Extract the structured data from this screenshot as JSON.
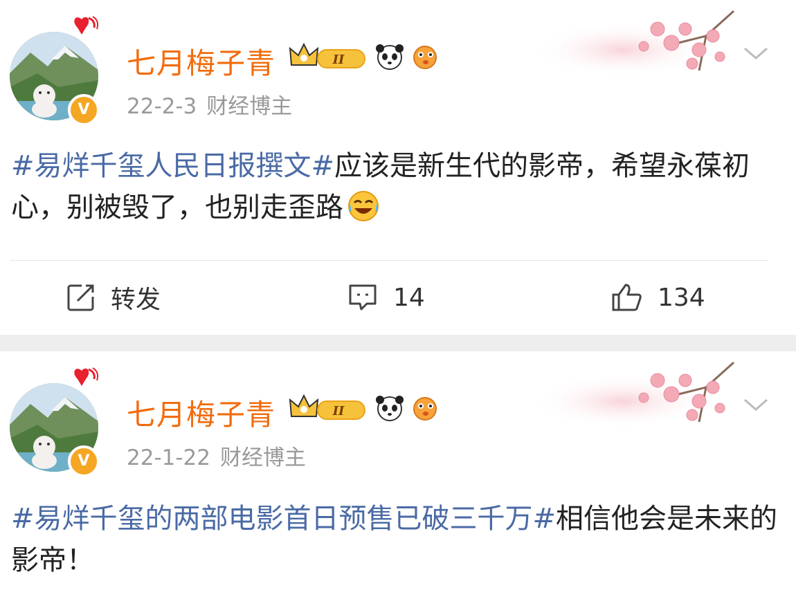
{
  "posts": [
    {
      "author": "七月梅子青",
      "date": "22-2-3",
      "tag": "财经博主",
      "verified_mark": "V",
      "crown_level": "II",
      "hashtag": "#易烊千玺人民日报撰文#",
      "text": "应该是新生代的影帝，希望永葆初心，别被毁了，也别走歪路",
      "emoji": "laugh-cry-icon",
      "actions": {
        "repost_label": "转发",
        "comment_count": "14",
        "like_count": "134"
      }
    },
    {
      "author": "七月梅子青",
      "date": "22-1-22",
      "tag": "财经博主",
      "verified_mark": "V",
      "crown_level": "II",
      "hashtag": "#易烊千玺的两部电影首日预售已破三千万#",
      "text": "相信他会是未来的影帝！"
    }
  ],
  "colors": {
    "name": "#f26c0d",
    "hashtag": "#4a6aa5",
    "meta": "#999999",
    "verified": "#f5a623",
    "separator": "#eeeeee"
  }
}
